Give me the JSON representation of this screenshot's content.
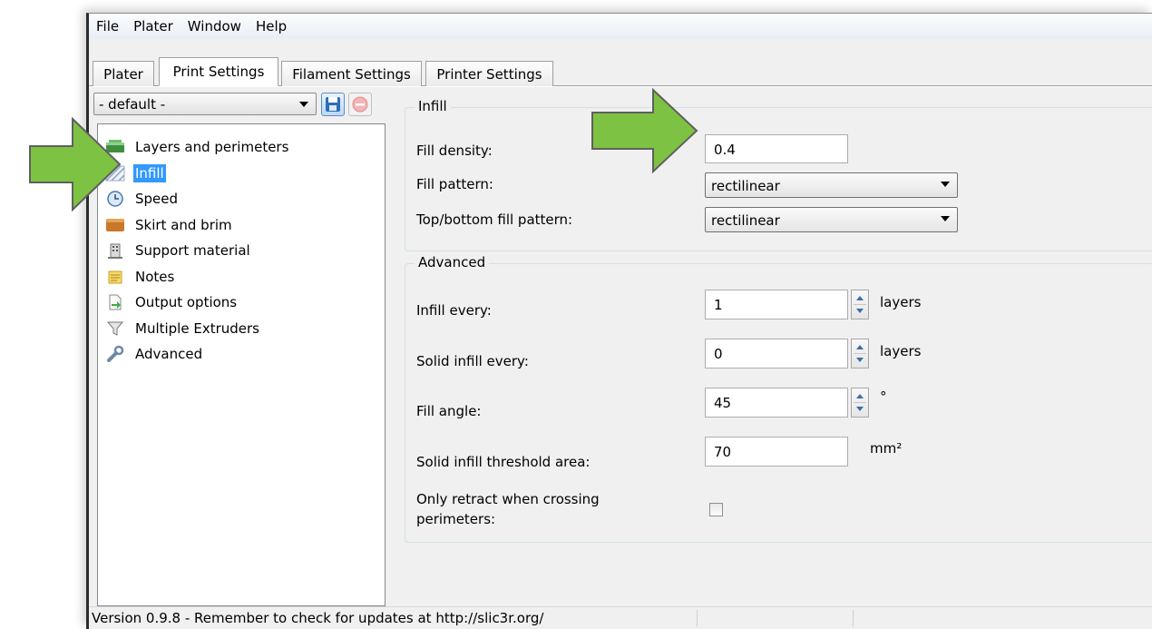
{
  "menubar": {
    "items": [
      "File",
      "Plater",
      "Window",
      "Help"
    ]
  },
  "tabs": [
    "Plater",
    "Print Settings",
    "Filament Settings",
    "Printer Settings"
  ],
  "active_tab": "Print Settings",
  "preset": {
    "value": "- default -"
  },
  "sidebar": {
    "items": [
      {
        "label": "Layers and perimeters",
        "icon": "layers-icon"
      },
      {
        "label": "Infill",
        "icon": "infill-icon",
        "selected": true
      },
      {
        "label": "Speed",
        "icon": "clock-icon"
      },
      {
        "label": "Skirt and brim",
        "icon": "box-icon"
      },
      {
        "label": "Support material",
        "icon": "building-icon"
      },
      {
        "label": "Notes",
        "icon": "note-icon"
      },
      {
        "label": "Output options",
        "icon": "export-icon"
      },
      {
        "label": "Multiple Extruders",
        "icon": "funnel-icon"
      },
      {
        "label": "Advanced",
        "icon": "wrench-icon"
      }
    ]
  },
  "infill": {
    "title": "Infill",
    "fill_density": {
      "label": "Fill density:",
      "value": "0.4"
    },
    "fill_pattern": {
      "label": "Fill pattern:",
      "value": "rectilinear"
    },
    "top_bottom_pattern": {
      "label": "Top/bottom fill pattern:",
      "value": "rectilinear"
    }
  },
  "advanced": {
    "title": "Advanced",
    "infill_every": {
      "label": "Infill every:",
      "value": "1",
      "unit": "layers"
    },
    "solid_infill_every": {
      "label": "Solid infill every:",
      "value": "0",
      "unit": "layers"
    },
    "fill_angle": {
      "label": "Fill angle:",
      "value": "45",
      "unit": "°"
    },
    "solid_threshold": {
      "label": "Solid infill threshold area:",
      "value": "70",
      "unit": "mm²"
    },
    "only_retract": {
      "label_line1": "Only retract when crossing",
      "label_line2": "perimeters:",
      "checked": false
    }
  },
  "status": {
    "text": "Version 0.9.8 - Remember to check for updates at http://slic3r.org/"
  },
  "colors": {
    "arrow": "#7dc242",
    "selection": "#3399ff"
  }
}
